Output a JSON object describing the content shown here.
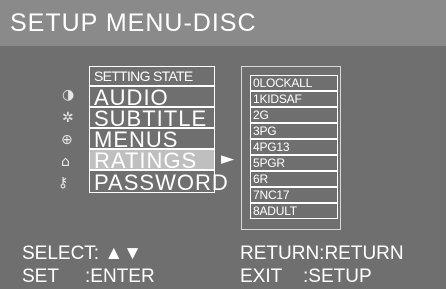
{
  "title": "SETUP MENU-DISC",
  "colors": {
    "background": "#6f6f6f",
    "titlebar": "#8a8a8a",
    "highlight": "#bfbfbf",
    "text": "#ffffff"
  },
  "menu": {
    "header": "SETTING STATE",
    "items": [
      {
        "label": "AUDIO",
        "icon": "contrast-icon"
      },
      {
        "label": "SUBTITLE",
        "icon": "gear-icon"
      },
      {
        "label": "MENUS",
        "icon": "target-icon"
      },
      {
        "label": "RATINGS",
        "icon": "lock-icon"
      },
      {
        "label": "PASSWORD",
        "icon": "key-icon"
      }
    ],
    "selected": "RATINGS"
  },
  "ratings": [
    "0LOCKALL",
    "1KIDSAF",
    "2G",
    "3PG",
    "4PG13",
    "5PGR",
    "6R",
    "7NC17",
    "8ADULT"
  ],
  "footer": {
    "select": "SELECT: ▲▼",
    "return": "RETURN:RETURN",
    "set": "SET     :ENTER",
    "exit": "EXIT    :SETUP"
  }
}
